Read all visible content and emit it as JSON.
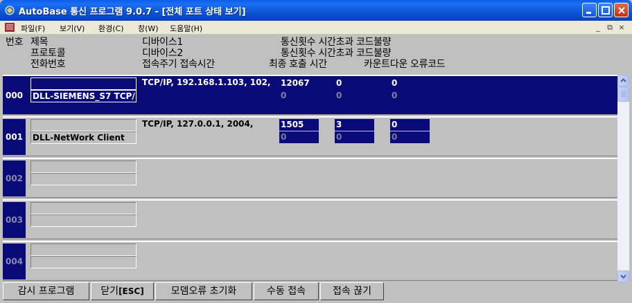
{
  "window": {
    "title": "AutoBase 통신 프로그램 9.0.7 - [전체 포트 상태 보기]",
    "icons": [
      "app-icon",
      "minimize-icon",
      "maximize-icon",
      "close-icon"
    ]
  },
  "menu": {
    "items": [
      "파일(F)",
      "보기(V)",
      "환경(C)",
      "창(W)",
      "도움말(H)"
    ],
    "mdi_buttons": [
      "_",
      "⧉",
      "×"
    ]
  },
  "header": {
    "col1_line1": "번호",
    "col2_line1": "제목",
    "col2_line2": "프로토콜",
    "col2_line3": "전화번호",
    "col3_line1": "디바이스1",
    "col3_line2": "디바이스2",
    "col3_line3": "접속주기 접속시간",
    "col4_line1": "통신횟수  시간초과   코드불량",
    "col4_line2": "통신횟수  시간초과   코드불량",
    "col4_line3": "최종 호출 시간",
    "col5_line3": "카운트다운   오류코드"
  },
  "rows": [
    {
      "num": "000",
      "title": "",
      "protocol": "DLL-SIEMENS_S7 TCP/",
      "device": "TCP/IP, 192.168.1.103, 102,",
      "count1": "12067",
      "timeout1": "0",
      "code1": "0",
      "count2": "0",
      "timeout2": "0",
      "code2": "0"
    },
    {
      "num": "001",
      "title": "",
      "protocol": "DLL-NetWork Client",
      "device": "TCP/IP, 127.0.0.1, 2004,",
      "count1": "1505",
      "timeout1": "3",
      "code1": "0",
      "count2": "0",
      "timeout2": "0",
      "code2": "0"
    },
    {
      "num": "002",
      "title": "",
      "protocol": "",
      "device": ""
    },
    {
      "num": "003",
      "title": "",
      "protocol": "",
      "device": ""
    },
    {
      "num": "004",
      "title": "",
      "protocol": "",
      "device": ""
    }
  ],
  "bottom_buttons": {
    "monitor": "감시 프로그램",
    "close_main": "닫기",
    "close_key": "[ESC]",
    "modem_reset": "모뎀오류 초기화",
    "manual_connect": "수동 접속",
    "disconnect": "접속 끊기"
  },
  "colors": {
    "selection": "#0a0a78",
    "panel": "#c0c0c0",
    "title_blue": "#0a5fe8"
  }
}
